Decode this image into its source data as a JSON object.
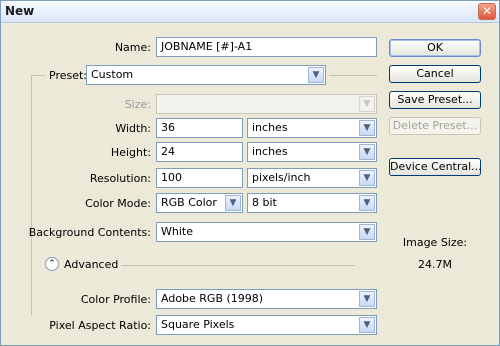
{
  "dialog": {
    "title": "New",
    "close_glyph": "✕"
  },
  "name": {
    "label": "Name:",
    "value": "JOBNAME [#]-A1"
  },
  "preset": {
    "label": "Preset:",
    "value": "Custom"
  },
  "size": {
    "label": "Size:",
    "value": ""
  },
  "width": {
    "label": "Width:",
    "value": "36",
    "unit": "inches"
  },
  "height": {
    "label": "Height:",
    "value": "24",
    "unit": "inches"
  },
  "resolution": {
    "label": "Resolution:",
    "value": "100",
    "unit": "pixels/inch"
  },
  "color_mode": {
    "label": "Color Mode:",
    "value": "RGB Color",
    "depth": "8 bit"
  },
  "background": {
    "label": "Background Contents:",
    "value": "White"
  },
  "advanced": {
    "label": "Advanced",
    "glyph": "⌃"
  },
  "color_profile": {
    "label": "Color Profile:",
    "value": "Adobe RGB (1998)"
  },
  "pixel_aspect": {
    "label": "Pixel Aspect Ratio:",
    "value": "Square Pixels"
  },
  "buttons": {
    "ok": "OK",
    "cancel": "Cancel",
    "save_preset": "Save Preset...",
    "delete_preset": "Delete Preset...",
    "device_central": "Device Central..."
  },
  "image_size": {
    "label": "Image Size:",
    "value": "24.7M"
  },
  "icons": {
    "dropdown": "chevron-down-icon",
    "collapse": "collapse-icon"
  }
}
